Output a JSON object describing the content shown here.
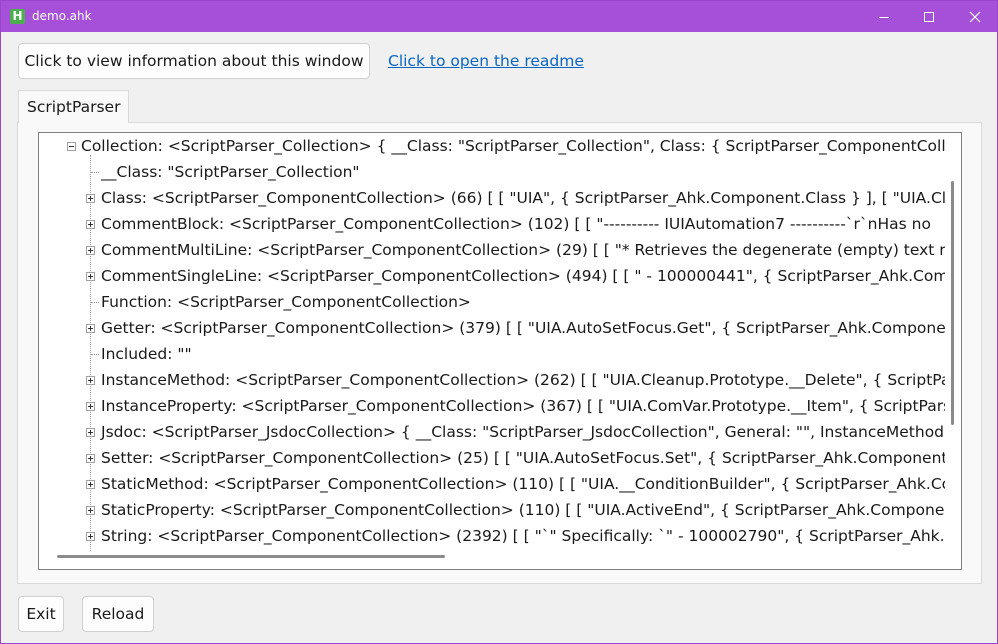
{
  "window": {
    "title": "demo.ahk",
    "app_icon_letter": "H",
    "title_bg": "#a64fd8"
  },
  "buttons": {
    "info": "Click to view information about this window",
    "exit": "Exit",
    "reload": "Reload"
  },
  "link": {
    "readme": "Click to open the readme"
  },
  "tab": {
    "label": "ScriptParser"
  },
  "tree": {
    "root": {
      "label": "Collection: <ScriptParser_Collection> { __Class: \"ScriptParser_Collection\", Class: { ScriptParser_ComponentCollectio",
      "expanded": true
    },
    "children": [
      {
        "label": "__Class: \"ScriptParser_Collection\"",
        "expandable": false
      },
      {
        "label": "Class: <ScriptParser_ComponentCollection> (66) [ [ \"UIA\", { ScriptParser_Ahk.Component.Class } ], [ \"UIA.Cleanu",
        "expandable": true
      },
      {
        "label": "CommentBlock: <ScriptParser_ComponentCollection> (102) [ [ \"---------- IUIAutomation7 ----------`r`nHas no",
        "expandable": true
      },
      {
        "label": "CommentMultiLine: <ScriptParser_ComponentCollection> (29) [ [ \"* Retrieves the degenerate (empty) text rang",
        "expandable": true
      },
      {
        "label": "CommentSingleLine: <ScriptParser_ComponentCollection> (494) [ [ \" - 100000441\", { ScriptParser_Ahk.Compon",
        "expandable": true
      },
      {
        "label": "Function: <ScriptParser_ComponentCollection>",
        "expandable": false
      },
      {
        "label": "Getter: <ScriptParser_ComponentCollection> (379) [ [ \"UIA.AutoSetFocus.Get\", { ScriptParser_Ahk.Component.G",
        "expandable": true
      },
      {
        "label": "Included: \"\"",
        "expandable": false
      },
      {
        "label": "InstanceMethod: <ScriptParser_ComponentCollection> (262) [ [ \"UIA.Cleanup.Prototype.__Delete\", { ScriptParse",
        "expandable": true
      },
      {
        "label": "InstanceProperty: <ScriptParser_ComponentCollection> (367) [ [ \"UIA.ComVar.Prototype.__Item\", { ScriptParser_",
        "expandable": true
      },
      {
        "label": "Jsdoc: <ScriptParser_JsdocCollection> { __Class: \"ScriptParser_JsdocCollection\", General: \"\", InstanceMethod: { S",
        "expandable": true
      },
      {
        "label": "Setter: <ScriptParser_ComponentCollection> (25) [ [ \"UIA.AutoSetFocus.Set\", { ScriptParser_Ahk.Component.Set",
        "expandable": true
      },
      {
        "label": "StaticMethod: <ScriptParser_ComponentCollection> (110) [ [ \"UIA.__ConditionBuilder\", { ScriptParser_Ahk.Comp",
        "expandable": true
      },
      {
        "label": "StaticProperty: <ScriptParser_ComponentCollection> (110) [ [ \"UIA.ActiveEnd\", { ScriptParser_Ahk.Component.S",
        "expandable": true
      },
      {
        "label": "String: <ScriptParser_ComponentCollection> (2392) [ [ \"`\"     Specifically: `\" - 100002790\", { ScriptParser_Ahk.Con",
        "expandable": true
      }
    ]
  }
}
